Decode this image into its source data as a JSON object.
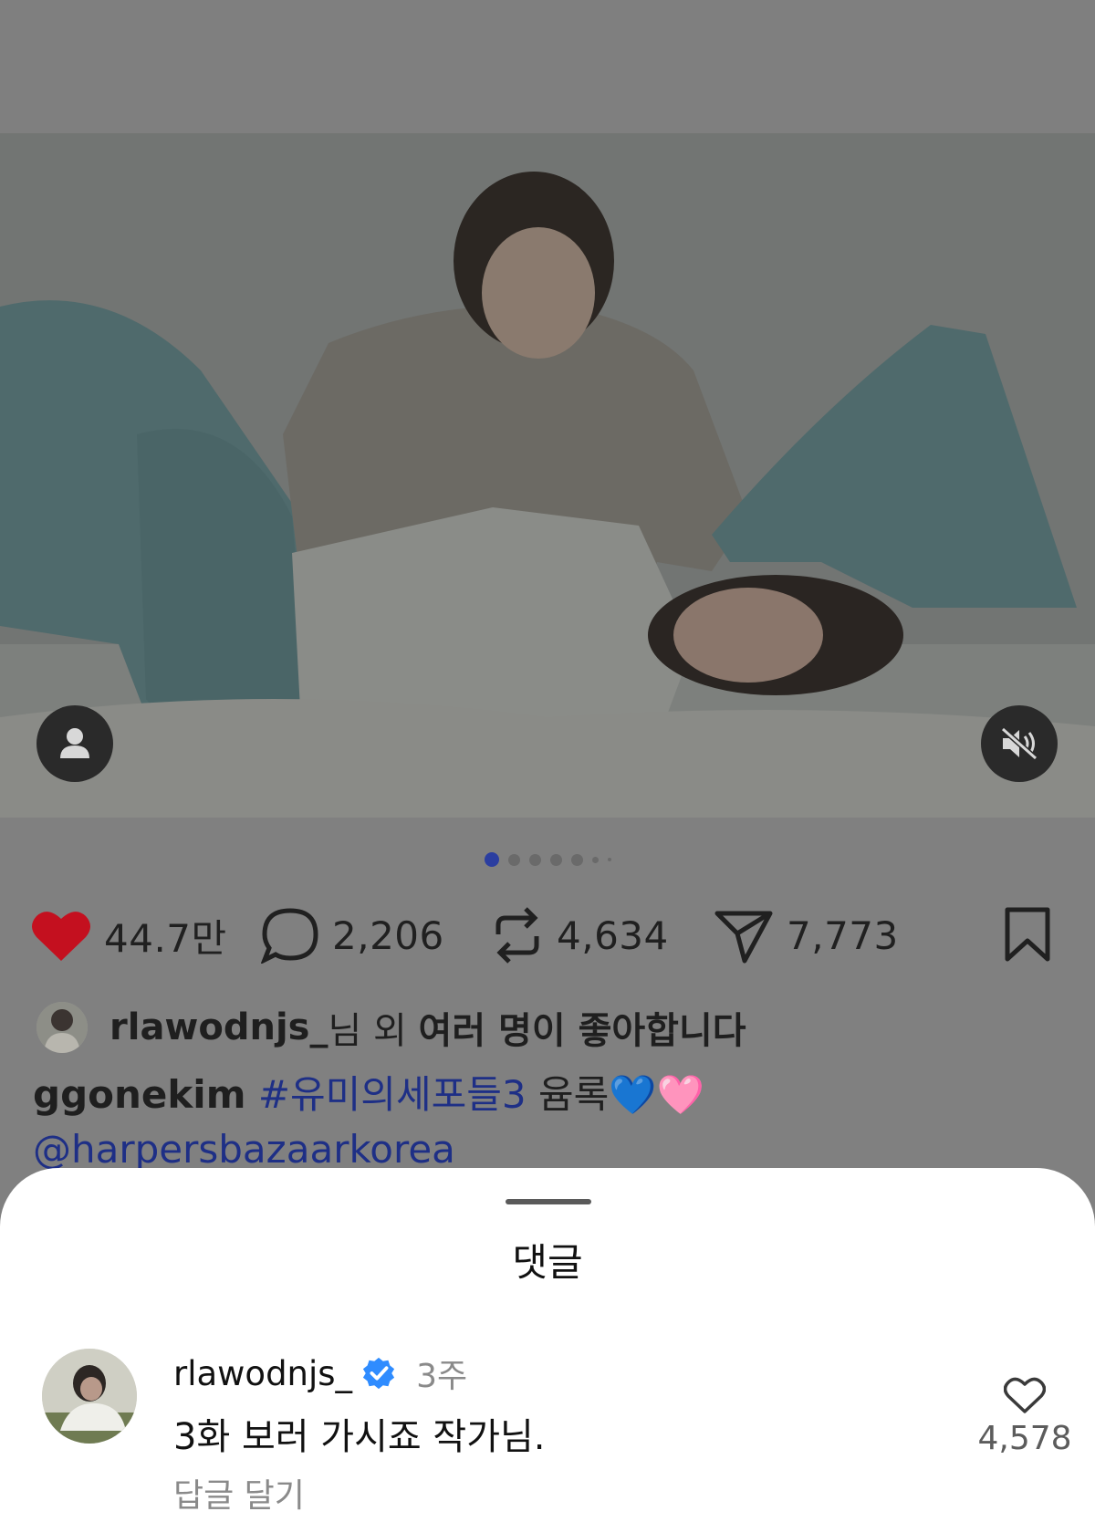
{
  "post": {
    "carousel_total": 6,
    "carousel_active": 1,
    "actions": {
      "likes": "44.7만",
      "comments": "2,206",
      "reposts": "4,634",
      "shares": "7,773"
    },
    "liked_by": {
      "user": "rlawodnjs_",
      "suffix_regular": "님 외 ",
      "suffix_bold": "여러 명이 좋아합니다"
    },
    "caption": {
      "user": "ggonekim",
      "hashtag": "#유미의세포들3",
      "text": "윰록",
      "emoji": "💙🩷",
      "mention": "@harpersbazaarkorea"
    }
  },
  "comments_sheet": {
    "title": "댓글",
    "comments": [
      {
        "user": "rlawodnjs_",
        "verified": true,
        "time": "3주",
        "text": "3화 보러 가시죠 작가님.",
        "reply_label": "답글 달기",
        "likes": "4,578"
      }
    ]
  },
  "colors": {
    "like_red": "#c4101f",
    "link_blue": "#1e2f86",
    "verified_blue": "#2f8cff"
  },
  "icons": [
    "heart-filled-icon",
    "comment-icon",
    "repost-icon",
    "share-icon",
    "bookmark-icon",
    "user-tag-icon",
    "muted-speaker-icon",
    "verified-badge-icon",
    "heart-outline-icon"
  ]
}
